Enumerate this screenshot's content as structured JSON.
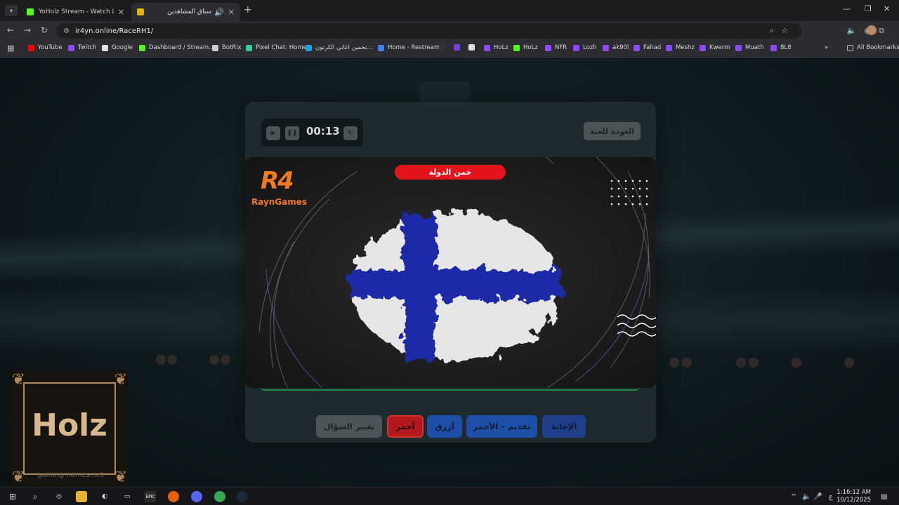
{
  "browser": {
    "tabs": [
      {
        "title": "YoHolz Stream - Watch Live on",
        "icon_color": "#53fc18",
        "active": false
      },
      {
        "title": "سباق المشاهدين",
        "icon_color": "#e7b400",
        "active": true
      }
    ],
    "url": "ir4yn.online/RaceRH1/",
    "all_bookmarks": "All Bookmarks",
    "bookmarks": [
      {
        "label": "YouTube",
        "color": "#ff0000"
      },
      {
        "label": "Twitch",
        "color": "#9146ff"
      },
      {
        "label": "Google",
        "color": "#e0e0e0"
      },
      {
        "label": "Dashboard / Stream...",
        "color": "#53fc18"
      },
      {
        "label": "BotRix",
        "color": "#cccccc"
      },
      {
        "label": "Pixel Chat: Home",
        "color": "#35c9a0"
      },
      {
        "label": "تخمين اغاني الكرتون...",
        "color": "#1fa3e0"
      },
      {
        "label": "Home - Restream",
        "color": "#3b82f6"
      },
      {
        "label": "",
        "color": "#333333"
      },
      {
        "label": "",
        "color": "#7b3fe4"
      },
      {
        "label": "",
        "color": "#dddddd"
      },
      {
        "label": "HoLz",
        "color": "#9146ff"
      },
      {
        "label": "HoLz",
        "color": "#53fc18"
      },
      {
        "label": "NFR",
        "color": "#9146ff"
      },
      {
        "label": "Lozh",
        "color": "#9146ff"
      },
      {
        "label": "ak90l",
        "color": "#9146ff"
      },
      {
        "label": "Fahad",
        "color": "#9146ff"
      },
      {
        "label": "Meshz",
        "color": "#9146ff"
      },
      {
        "label": "Kwerm",
        "color": "#9146ff"
      },
      {
        "label": "Muath",
        "color": "#9146ff"
      },
      {
        "label": "8L8",
        "color": "#9146ff"
      }
    ]
  },
  "game": {
    "timer": "00:13",
    "back_label": "العودة للعبة",
    "question_banner": "خمن الدولة",
    "logo_mark": "R4",
    "logo_text": "RaynGames",
    "flag": "finland",
    "buttons": {
      "change_question": "تغيير السؤال",
      "red": "أحمر",
      "blue": "أزرق",
      "advance_red": "تقديم – الأحمر",
      "answer": "الإجابة"
    },
    "colors": {
      "red": "#b3181c",
      "blue": "#1d4fa8",
      "answer": "#1f3f8a",
      "gray": "#4b5558"
    }
  },
  "overlay": {
    "brand": "Holz",
    "watermark": "gaming-names.net"
  },
  "taskbar": {
    "time": "1:16:12 AM",
    "date": "10/12/2025",
    "lang": "ع"
  }
}
